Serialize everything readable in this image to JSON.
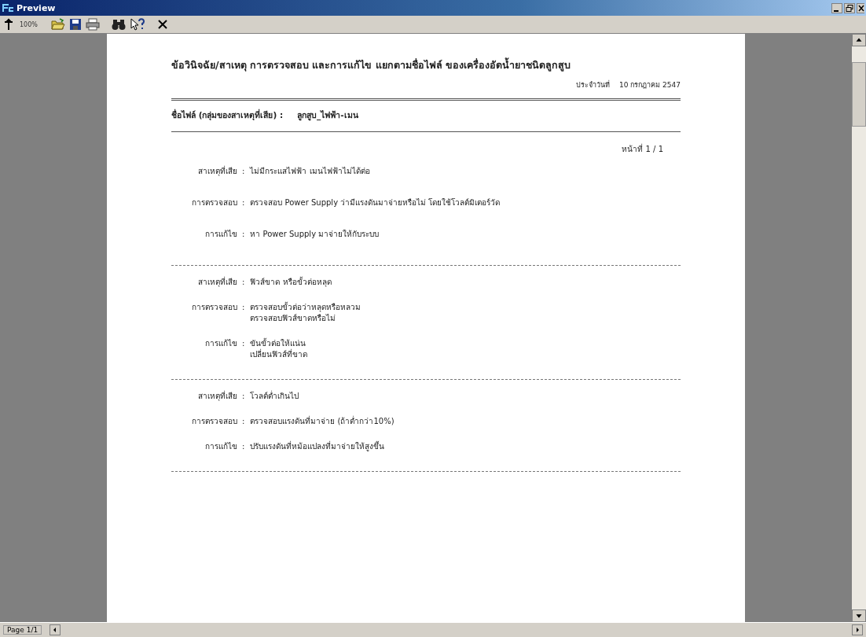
{
  "window": {
    "title": "Preview"
  },
  "toolbar": {
    "zoom": "100%"
  },
  "report": {
    "title": "ข้อวินิจฉัย/สาเหตุ การตรวจสอบ และการแก้ไข แยกตามชื่อไฟล์ ของเครื่องอัดน้ำยาชนิดลูกสูบ",
    "date_label": "ประจำวันที่",
    "date": "10 กรกฎาคม 2547",
    "file_label": "ชื่อไฟล์ (กลุ่มของสาเหตุที่เสีย) :",
    "file_name": "ลูกสูบ_ไฟฟ้า-เมน",
    "page": "หน้าที่ 1 / 1",
    "sections": [
      {
        "rows": [
          {
            "label": "สาเหตุที่เสีย",
            "sep": ":",
            "lines": [
              "ไม่มีกระแสไฟฟ้า เมนไฟฟ้าไม่ได้ต่อ"
            ]
          },
          {
            "label": "การตรวจสอบ",
            "sep": ":",
            "lines": [
              "ตรวจสอบ Power Supply ว่ามีแรงดันมาจ่ายหรือไม่ โดยใช้โวลต์มิเตอร์วัด"
            ]
          },
          {
            "label": "การแก้ไข",
            "sep": ":",
            "lines": [
              "หา Power Supply มาจ่ายให้กับระบบ"
            ]
          }
        ]
      },
      {
        "rows": [
          {
            "label": "สาเหตุที่เสีย",
            "sep": ":",
            "lines": [
              "ฟิวส์ขาด หรือขั้วต่อหลุด"
            ]
          },
          {
            "label": "การตรวจสอบ",
            "sep": ":",
            "lines": [
              "ตรวจสอบขั้วต่อว่าหลุดหรือหลวม",
              "ตรวจสอบฟิวส์ขาดหรือไม่"
            ]
          },
          {
            "label": "การแก้ไข",
            "sep": ":",
            "lines": [
              "ขันขั้วต่อให้แน่น",
              "เปลี่ยนฟิวส์ที่ขาด"
            ]
          }
        ]
      },
      {
        "rows": [
          {
            "label": "สาเหตุที่เสีย",
            "sep": ":",
            "lines": [
              "โวลต์ต่ำเกินไป"
            ]
          },
          {
            "label": "การตรวจสอบ",
            "sep": ":",
            "lines": [
              "ตรวจสอบแรงดันที่มาจ่าย (ถ้าต่ำกว่า10%)"
            ]
          },
          {
            "label": "การแก้ไข",
            "sep": ":",
            "lines": [
              "ปรับแรงดันที่หม้อแปลงที่มาจ่ายให้สูงขึ้น"
            ]
          }
        ]
      }
    ]
  },
  "status_bar": {
    "page": "Page 1/1"
  }
}
